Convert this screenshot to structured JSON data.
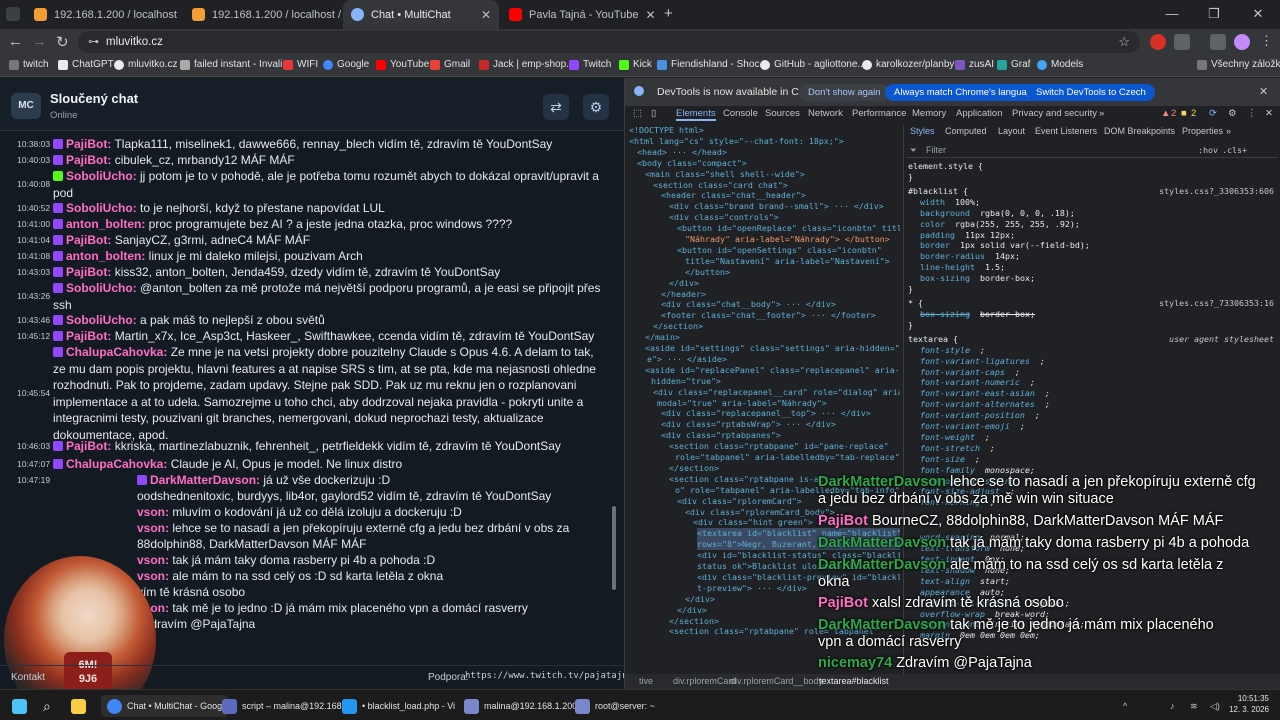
{
  "browser": {
    "tabs": [
      {
        "label": "192.168.1.200 / localhost / mluv"
      },
      {
        "label": "192.168.1.200 / localhost / mluv"
      },
      {
        "label": "Chat • MultiChat"
      },
      {
        "label": "Pavla Tajná - YouTube"
      }
    ],
    "url": "mluvitko.cz",
    "bookmarks": [
      "twitch",
      "ChatGPT",
      "mluvitko.cz",
      "failed instant - Invali...",
      "WIFI",
      "Google",
      "YouTube",
      "Gmail",
      "Jack | emp-shop.cz",
      "Twitch",
      "Kick",
      "Fiendishland - Shoc...",
      "GitHub - agliottone...",
      "karolkozer/planby",
      "zusAI",
      "Graf",
      "Models"
    ],
    "all_bookmarks": "Všechny záložky"
  },
  "chat": {
    "brand_initials": "MC",
    "title": "Sloučený chat",
    "status": "Online",
    "messages": [
      {
        "time": "10:38:03",
        "user": "PajiBot:",
        "color": "#ff6ec7",
        "badge": "twitch",
        "text": "Tlapka111, miselinek1, dawwe666, rennay_blech vidím tě, zdravím tě YouDontSay"
      },
      {
        "time": "10:40:03",
        "user": "PajiBot:",
        "color": "#ff6ec7",
        "badge": "twitch",
        "text": "cibulek_cz, mrbandy12 MÁF MÁF"
      },
      {
        "time": "10:40:08",
        "user": "SoboliUcho:",
        "color": "#ff6ec7",
        "badge": "kick",
        "text": "jj potom je to v pohodě, ale je potřeba tomu rozumět abych to dokázal opravit/upravit a pod"
      },
      {
        "time": "10:40:52",
        "user": "SoboliUcho:",
        "color": "#ff6ec7",
        "badge": "twitch",
        "text": "to je nejhorší, když to přestane napovídat LUL"
      },
      {
        "time": "10:41:00",
        "user": "anton_bolten:",
        "color": "#ff6ec7",
        "badge": "twitch",
        "text": "proc programujete bez AI ? a jeste jedna otazka, proc windows ????"
      },
      {
        "time": "10:41:04",
        "user": "PajiBot:",
        "color": "#ff6ec7",
        "badge": "twitch",
        "text": "SanjayCZ, g3rmi, adneC4 MÁF MÁF"
      },
      {
        "time": "10:41:08",
        "user": "anton_bolten:",
        "color": "#ff6ec7",
        "badge": "twitch",
        "text": "linux je mi daleko milejsi, pouzivam Arch"
      },
      {
        "time": "10:43:03",
        "user": "PajiBot:",
        "color": "#ff6ec7",
        "badge": "twitch",
        "text": "kiss32, anton_bolten, Jenda459, dzedy vidím tě, zdravím tě YouDontSay"
      },
      {
        "time": "10:43:26",
        "user": "SoboliUcho:",
        "color": "#ff6ec7",
        "badge": "twitch",
        "text": "@anton_bolten za mě protože má největší podporu programů, a je easi se připojit přes ssh"
      },
      {
        "time": "10:43:46",
        "user": "SoboliUcho:",
        "color": "#ff6ec7",
        "badge": "twitch",
        "text": "a pak máš to nejlepší z obou světů"
      },
      {
        "time": "10:45:12",
        "user": "PajiBot:",
        "color": "#ff6ec7",
        "badge": "twitch",
        "text": "Martin_x7x, Ice_Asp3ct, Haskeer_, Swifthawkee, ccenda vidím tě, zdravím tě YouDontSay"
      },
      {
        "time": "10:45:54",
        "user": "ChalupaCahovka:",
        "color": "#ff6ec7",
        "badge": "twitch",
        "text": "Ze mne je na vetsi projekty dobre pouzitelny Claude s Opus 4.6. A delam to tak, ze mu dam popis projektu, hlavni features a at napise SRS s tim, at se pta, kde ma nejasnosti ohledne rozhodnuti. Pak to projdeme, zadam updavy. Stejne pak SDD. Pak uz mu reknu jen o rozplanovani implementace a at to udela. Samozrejme u toho chci, aby dodrzoval nejaka pravidla - pokryti unite a integracnimi testy, pouzivani git branches, nemergovani, dokud neprochazi testy, aktualizace dokoumentace, apod."
      },
      {
        "time": "10:46:03",
        "user": "PajiBot:",
        "color": "#ff6ec7",
        "badge": "twitch",
        "text": "kkriska, martinezlabuznik, fehrenheit_, petrfieldekk vidím tě, zdravím tě YouDontSay"
      },
      {
        "time": "10:47:07",
        "user": "ChalupaCahovka:",
        "color": "#ff6ec7",
        "badge": "twitch",
        "text": "Claude je AI, Opus je model. Ne linux distro"
      },
      {
        "time": "10:47:19",
        "user": "DarkMatterDavson:",
        "color": "#ff6ec7",
        "badge": "twitch",
        "text": "já už vše dockerizuju :D"
      },
      {
        "time": "",
        "user": "",
        "color": "#ff6ec7",
        "badge": "",
        "text": "oodshednenitoxic, burdyys, lib4or, gaylord52 vidím tě, zdravím tě YouDontSay"
      },
      {
        "time": "",
        "user": "vson:",
        "color": "#ff6ec7",
        "badge": "",
        "text": "mluvím o kodování já už co dělá izoluju a dockeruju :D"
      },
      {
        "time": "",
        "user": "vson:",
        "color": "#ff6ec7",
        "badge": "",
        "text": "lehce se to nasadí a jen překopíruju externě cfg a jedu bez drbání v obs za"
      },
      {
        "time": "",
        "user": "",
        "color": "#ff6ec7",
        "badge": "",
        "text": "88dolphin88, DarkMatterDavson MÁF MÁF"
      },
      {
        "time": "",
        "user": "vson:",
        "color": "#ff6ec7",
        "badge": "",
        "text": "tak já mám taky doma rasberry pi 4b a pohoda :D"
      },
      {
        "time": "",
        "user": "vson:",
        "color": "#ff6ec7",
        "badge": "",
        "text": "ale mám to na ssd celý os :D sd karta letěla z okna"
      },
      {
        "time": "",
        "user": "",
        "color": "#ff6ec7",
        "badge": "",
        "text": "vím tě krásná osobo"
      },
      {
        "time": "",
        "user": "vson:",
        "color": "#ff6ec7",
        "badge": "",
        "text": "tak mě je to jedno :D já mám mix placeného vpn a domácí rasverry"
      },
      {
        "time": "10:51:3",
        "user": "",
        "color": "#ff6ec7",
        "badge": "",
        "text": "Zdravím @PajaTajna"
      }
    ],
    "footer_left": "Kontakt",
    "footer_support_label": "Podpora:",
    "footer_support_url": "https://www.twitch.tv/pajatajna"
  },
  "devtools": {
    "banner": "DevTools is now available in Czech",
    "btn_dont_show": "Don't show again",
    "btn_match": "Always match Chrome's language",
    "btn_switch": "Switch DevTools to Czech",
    "tabs": [
      "Elements",
      "Console",
      "Sources",
      "Network",
      "Performance",
      "Memory",
      "Application",
      "Privacy and security"
    ],
    "warn_count": "2",
    "err_count": "2",
    "style_tabs": [
      "Styles",
      "Computed",
      "Layout",
      "Event Listeners",
      "DOM Breakpoints",
      "Properties"
    ],
    "filter_placeholder": "Filter",
    "filter_hov": ":hov",
    "filter_cls": ".cls",
    "dom_lines": [
      "<!DOCTYPE html>",
      "<html lang=\"cs\" style=\"--chat-font: 18px;\">",
      "<head> ··· </head>",
      "<body class=\"compact\">",
      "<main class=\"shell shell--wide\">",
      "<section class=\"card chat\">",
      "<header class=\"chat__header\">",
      "<div class=\"brand brand--small\"> ··· </div>",
      "<div class=\"controls\">",
      "<button id=\"openReplace\" class=\"iconbtn\" title=",
      "\"Náhrady\" aria-label=\"Náhrady\"> </button>",
      "<button id=\"openSettings\" class=\"iconbtn\"",
      "title=\"Nastavení\" aria-label=\"Nastavení\">",
      "</button>",
      "</div>",
      "</header>",
      "<div class=\"chat__body\"> ··· </div>",
      "<footer class=\"chat__footer\"> ··· </footer>",
      "</section>",
      "</main>",
      "<aside id=\"settings\" class=\"settings\" aria-hidden=\"tru",
      "e\"> ··· </aside>",
      "<aside id=\"replacePanel\" class=\"replacepanel\" aria-",
      "hidden=\"true\">",
      "<div class=\"replacepanel__card\" role=\"dialog\" aria-",
      "modal=\"true\" aria-label=\"Náhrady\">",
      "<div class=\"replacepanel__top\"> ··· </div>",
      "<div class=\"rptabsWrap\"> ··· </div>",
      "<div class=\"rptabpanes\">",
      "<section class=\"rptabpane\" id=\"pane-replace\"",
      "role=\"tabpanel\" aria-labelledby=\"tab-replace\">",
      "</section>",
      "<section class=\"rptabpane is-act",
      "o\" role=\"tabpanel\" aria-labelledby=\"tab-info\">",
      "<div class=\"rploremCard\">",
      "<div class=\"rploremCard_body\">",
      "<div class=\"hint green\"> ···",
      "<textarea id=\"blacklist\" name=\"blacklist\"",
      "rows=\"8\">Negr, Buzerant, </textarea> == $0",
      "<div id=\"blacklist-status\" class=\"blacklist-",
      "status ok\">Blacklist uložen.</div>",
      "<div class=\"blacklist-preview\" id=\"blacklis",
      "t-preview\"> ··· </div>",
      "</div>",
      "</div>",
      "</section>",
      "<section class=\"rptabpane\" role=\"tabpanel\""
    ],
    "style_rules": [
      {
        "selector": "element.style {",
        "source": "",
        "props": []
      },
      {
        "selector": "#blacklist {",
        "source": "styles.css?_3306353:606",
        "props": [
          [
            "width",
            "100%;"
          ],
          [
            "background",
            "rgba(0, 0, 0, .18);"
          ],
          [
            "color",
            "rgba(255, 255, 255, .92);"
          ],
          [
            "padding",
            "11px 12px;"
          ],
          [
            "border",
            "1px solid var(--field-bd);"
          ],
          [
            "border-radius",
            "14px;"
          ],
          [
            "line-height",
            "1.5;"
          ],
          [
            "box-sizing",
            "border-box;"
          ]
        ]
      },
      {
        "selector": "* {",
        "source": "styles.css?_73306353:16",
        "props": [
          [
            "box-sizing",
            "border-box;"
          ]
        ]
      },
      {
        "selector": "textarea {",
        "source": "user agent stylesheet",
        "props": [
          [
            "font-style",
            ";"
          ],
          [
            "font-variant-ligatures",
            ";"
          ],
          [
            "font-variant-caps",
            ";"
          ],
          [
            "font-variant-numeric",
            ";"
          ],
          [
            "font-variant-east-asian",
            ";"
          ],
          [
            "font-variant-alternates",
            ";"
          ],
          [
            "font-variant-position",
            ";"
          ],
          [
            "font-variant-emoji",
            ";"
          ],
          [
            "font-weight",
            ";"
          ],
          [
            "font-stretch",
            ";"
          ],
          [
            "font-size",
            ";"
          ],
          [
            "font-family",
            "monospace;"
          ],
          [
            "font-optical-sizing",
            ";"
          ],
          [
            "font-size-adjust",
            ";"
          ],
          [
            "font-kerning",
            ";"
          ]
        ]
      }
    ],
    "style_tail": [
      [
        "word-spacing",
        "normal;"
      ],
      [
        "text-transform",
        "none;"
      ],
      [
        "text-indent",
        "0px;"
      ],
      [
        "text-shadow",
        "none;"
      ],
      [
        "text-align",
        "start;"
      ],
      [
        "appearance",
        "auto;"
      ],
      [
        "-webkit-rtl-ordering",
        "logical;"
      ],
      [
        "overflow-wrap",
        "break-word;"
      ],
      [
        "column-count",
        "initial !important;"
      ],
      [
        "margin",
        "0em 0em 0em 0em;"
      ]
    ],
    "breadcrumb": [
      "tive",
      "div.rploremCard",
      "div.rploremCard__body",
      "textarea#blacklist"
    ]
  },
  "overlay": [
    {
      "user": "DarkMatterDavson",
      "text": "lehce se to nasadí a jen překopíruju externě cfg"
    },
    {
      "user": "",
      "text": "a jedu bez drbání v obs za mě win win situace"
    },
    {
      "user": "PajiBot",
      "text": "BourneCZ, 88dolphin88, DarkMatterDavson MÁF MÁF"
    },
    {
      "user": "DarkMatterDavson",
      "text": "tak já mám taky doma rasberry pi 4b a pohoda"
    },
    {
      "user": "DarkMatterDavson",
      "text": "ale mám to na ssd celý os  sd karta letěla z"
    },
    {
      "user": "",
      "text": "okna"
    },
    {
      "user": "PajiBot",
      "text": "xalsl zdravím tě krásná osobo"
    },
    {
      "user": "DarkMatterDavson",
      "text": "tak mě je to jedno  já mám mix placeného"
    },
    {
      "user": "",
      "text": "vpn a domácí rasverry"
    },
    {
      "user": "nicemay74",
      "text": "Zdravím @PajaTajna"
    }
  ],
  "taskbar": {
    "items": [
      "Chat • MultiChat - Goog",
      "script – malina@192.168",
      "• blacklist_load.php - Vi",
      "malina@192.168.1.200",
      "root@server: ~"
    ],
    "time": "10:51:35",
    "date": "12. 3. 2026"
  },
  "colors": {
    "accent": "#8ab4f8",
    "chat_bg": "#141a21",
    "username": "#ff6ec7",
    "overlay_user": "#2ea84a"
  }
}
